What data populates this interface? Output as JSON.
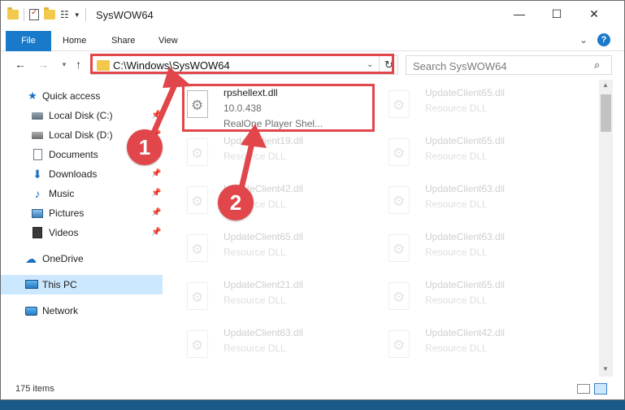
{
  "window": {
    "title": "SysWOW64",
    "controls": {
      "minimize": "—",
      "maximize": "☐",
      "close": "✕"
    }
  },
  "ribbon": {
    "file": "File",
    "tabs": [
      "Home",
      "Share",
      "View"
    ],
    "help": "?"
  },
  "address": {
    "path": "C:\\Windows\\SysWOW64",
    "search_placeholder": "Search SysWOW64"
  },
  "sidebar": {
    "items": [
      {
        "label": "Quick access"
      },
      {
        "label": "Local Disk (C:)"
      },
      {
        "label": "Local Disk (D:)"
      },
      {
        "label": "Documents"
      },
      {
        "label": "Downloads"
      },
      {
        "label": "Music"
      },
      {
        "label": "Pictures"
      },
      {
        "label": "Videos"
      },
      {
        "label": "OneDrive"
      },
      {
        "label": "This PC"
      },
      {
        "label": "Network"
      }
    ]
  },
  "files": [
    {
      "name": "rpshellext.dll",
      "version": "10.0.438",
      "description": "RealOne Player Shel..."
    },
    {
      "name": "UpdateClient65.dll",
      "description": "Resource DLL"
    },
    {
      "name": "UpdateClient19.dll",
      "description": "Resource DLL"
    },
    {
      "name": "UpdateClient65.dll",
      "description": "Resource DLL"
    },
    {
      "name": "UpdateClient42.dll",
      "description": "Resource DLL"
    },
    {
      "name": "UpdateClient63.dll",
      "description": "Resource DLL"
    },
    {
      "name": "UpdateClient65.dll",
      "description": "Resource DLL"
    },
    {
      "name": "UpdateClient63.dll",
      "description": "Resource DLL"
    },
    {
      "name": "UpdateClient21.dll",
      "description": "Resource DLL"
    },
    {
      "name": "UpdateClient65.dll",
      "description": "Resource DLL"
    },
    {
      "name": "UpdateClient63.dll",
      "description": "Resource DLL"
    },
    {
      "name": "UpdateClient42.dll",
      "description": "Resource DLL"
    }
  ],
  "status": {
    "item_count": "175 items"
  },
  "annotations": {
    "step1": "1",
    "step2": "2",
    "color": "#e0464a"
  }
}
